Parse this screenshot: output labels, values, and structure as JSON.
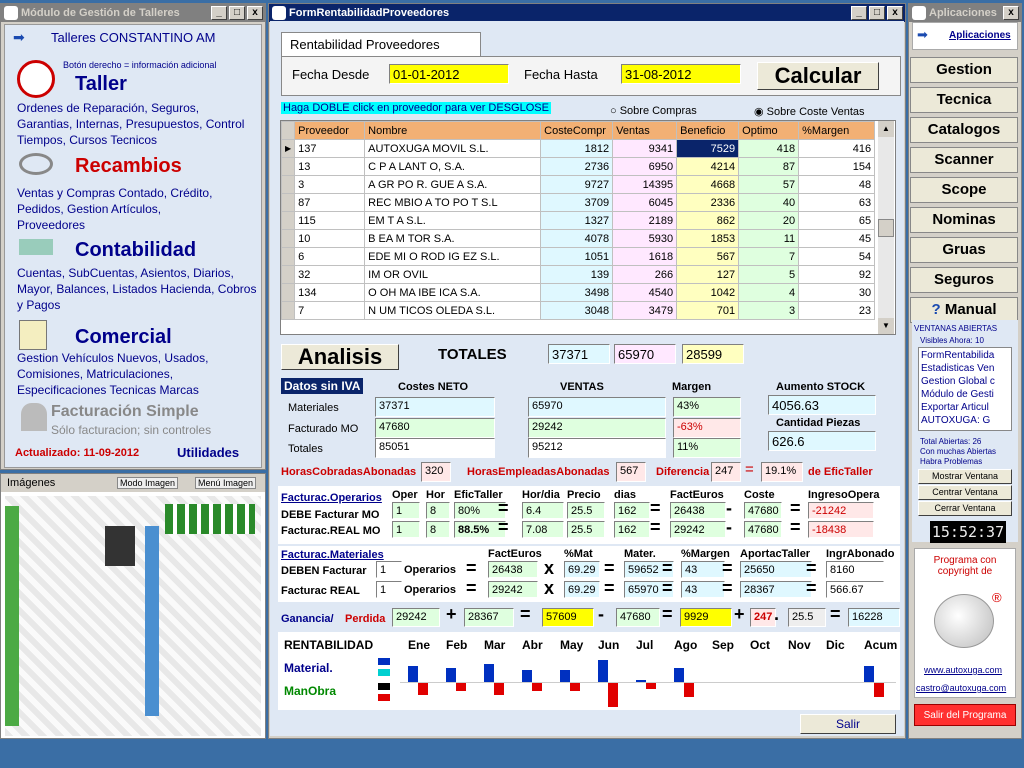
{
  "left_window": {
    "title": "Módulo de Gestión de Talleres",
    "company": "Talleres CONSTANTINO AM",
    "hint": "Botón derecho = información adicional",
    "taller": {
      "title": "Taller",
      "desc": "Ordenes de Reparación, Seguros, Garantias, Internas, Presupuestos, Control Tiempos, Cursos Tecnicos"
    },
    "recambios": {
      "title": "Recambios",
      "desc": "Ventas y Compras Contado, Crédito, Pedidos, Gestion Artículos, Proveedores"
    },
    "contabilidad": {
      "title": "Contabilidad",
      "desc": "Cuentas, SubCuentas, Asientos, Diarios, Mayor, Balances, Listados Hacienda, Cobros y Pagos"
    },
    "comercial": {
      "title": "Comercial",
      "desc": "Gestion Vehículos Nuevos, Usados, Comisiones, Matriculaciones, Especificaciones Tecnicas Marcas"
    },
    "facturacion": {
      "title": "Facturación Simple",
      "desc": "Sólo facturacion; sin controles"
    },
    "updated": "Actualizado: 11-09-2012",
    "utilidades": "Utilidades"
  },
  "images_panel": {
    "title": "Imágenes",
    "mode": "Modo Imagen",
    "menu": "Menú Imagen"
  },
  "form": {
    "title": "FormRentabilidadProveedores",
    "tab": "Rentabilidad Proveedores",
    "fecha_desde_label": "Fecha Desde",
    "fecha_desde": "01-01-2012",
    "fecha_hasta_label": "Fecha Hasta",
    "fecha_hasta": "31-08-2012",
    "calcular": "Calcular",
    "hint": "Haga DOBLE click en proveedor para ver DESGLOSE",
    "radio1": "Sobre Compras",
    "radio2": "Sobre Coste Ventas",
    "columns": [
      "Proveedor",
      "Nombre",
      "CosteCompr",
      "Ventas",
      "Beneficio",
      "Optimo",
      "%Margen"
    ],
    "rows": [
      [
        "137",
        "AUTOXUGA MOVIL S.L.",
        "1812",
        "9341",
        "7529",
        "418",
        "416"
      ],
      [
        "13",
        "C   P  A  LANT   O, S.A.",
        "2736",
        "6950",
        "4214",
        "87",
        "154"
      ],
      [
        "3",
        "A   GR  PO R. GUE   A S.A.",
        "9727",
        "14395",
        "4668",
        "57",
        "48"
      ],
      [
        "87",
        "REC  MBIO   A  TO  PO  T S.L",
        "3709",
        "6045",
        "2336",
        "40",
        "63"
      ],
      [
        "115",
        "EM  T  A S.L.",
        "1327",
        "2189",
        "862",
        "20",
        "65"
      ],
      [
        "10",
        "B  EA M   TOR S.A.",
        "4078",
        "5930",
        "1853",
        "11",
        "45"
      ],
      [
        "6",
        "EDE  MI  O ROD  IG  EZ S.L.",
        "1051",
        "1618",
        "567",
        "7",
        "54"
      ],
      [
        "32",
        "IM  OR   OVIL",
        "139",
        "266",
        "127",
        "5",
        "92"
      ],
      [
        "134",
        "  O  OH  MA IBE   ICA S.A.",
        "3498",
        "4540",
        "1042",
        "4",
        "30"
      ],
      [
        "7",
        "N  UM  TICOS   OLEDA  S.L.",
        "3048",
        "3479",
        "701",
        "3",
        "23"
      ]
    ],
    "analisis": "Analisis",
    "totales_label": "TOTALES",
    "tot1": "37371",
    "tot2": "65970",
    "tot3": "28599",
    "datos_iva": "Datos sin IVA",
    "costes_neto": "Costes NETO",
    "ventas": "VENTAS",
    "margen": "Margen",
    "aumento_stock": "Aumento STOCK",
    "cantidad_piezas": "Cantidad Piezas",
    "materiales_lbl": "Materiales",
    "facturado_lbl": "Facturado MO",
    "totales_lbl": "Totales",
    "mat_coste": "37371",
    "mat_ventas": "65970",
    "mat_margen": "43%",
    "stock": "4056.63",
    "mo_coste": "47680",
    "mo_ventas": "29242",
    "mo_margen": "-63%",
    "piezas": "626.6",
    "tot_coste": "85051",
    "tot_ventas": "95212",
    "tot_margen": "11%",
    "horas_cob_lbl": "HorasCobradasAbonadas",
    "horas_cob": "320",
    "horas_emp_lbl": "HorasEmpleadasAbonadas",
    "horas_emp": "567",
    "dif_lbl": "Diferencia",
    "dif": "247",
    "eq": "=",
    "dif_pct": "19.1%",
    "de_efic": "de EficTaller",
    "fo_lbl": "Facturac.Operarios",
    "fo_heads": [
      "Oper",
      "Hor",
      "EficTaller",
      "Hor/dia",
      "Precio",
      "dias",
      "FactEuros",
      "Coste",
      "IngresoOpera"
    ],
    "debe_mo_lbl": "DEBE Facturar MO",
    "debe_mo": [
      "1",
      "8",
      "80%",
      "6.4",
      "25.5",
      "162",
      "26438",
      "47680",
      "-21242"
    ],
    "real_mo_lbl": "Facturac.REAL MO",
    "real_mo": [
      "1",
      "8",
      "88.5%",
      "7.08",
      "25.5",
      "162",
      "29242",
      "47680",
      "-18438"
    ],
    "fm_lbl": "Facturac.Materiales",
    "fm_heads": [
      "FactEuros",
      "%Mat",
      "Mater.",
      "%Margen",
      "AportacTaller",
      "IngrAbonado"
    ],
    "deben_lbl": "DEBEN Facturar",
    "operarios": "Operarios",
    "deben": [
      "1",
      "26438",
      "69.29",
      "59652",
      "43",
      "25650",
      "8160"
    ],
    "freal_lbl": "Facturac REAL",
    "freal": [
      "1",
      "29242",
      "69.29",
      "65970",
      "43",
      "28367",
      "566.67"
    ],
    "ganancia_lbl": "Ganancia/",
    "perdida_lbl": "Perdida",
    "gan": [
      "29242",
      "28367",
      "57609",
      "47680",
      "9929",
      "247",
      "25.5",
      "16228"
    ],
    "rent_lbl": "RENTABILIDAD",
    "months": [
      "Ene",
      "Feb",
      "Mar",
      "Abr",
      "May",
      "Jun",
      "Jul",
      "Ago",
      "Sep",
      "Oct",
      "Nov",
      "Dic",
      "Acum"
    ],
    "material_lbl": "Material.",
    "manobra_lbl": "ManObra",
    "salir": "Salir"
  },
  "right_window": {
    "title": "Aplicaciones",
    "apps": "Aplicaciones",
    "buttons": [
      "Gestion",
      "Tecnica",
      "Catalogos",
      "Scanner",
      "Scope",
      "Nominas",
      "Gruas",
      "Seguros",
      "Manual"
    ],
    "ventanas": "VENTANAS ABIERTAS",
    "visibles": "Visibles Ahora: 10",
    "list": [
      "FormRentabilida",
      "Estadisticas Ven",
      "Gestion Global c",
      "Módulo de Gesti",
      "Exportar Articul",
      "AUTOXUGA: G"
    ],
    "total": "Total Abiertas: 26",
    "con_muchas": "Con muchas Abiertas",
    "habra": "Habra Problemas",
    "mostrar": "Mostrar Ventana",
    "centrar": "Centrar Ventana",
    "cerrar": "Cerrar Ventana",
    "clock": "15:52:37",
    "copyright": "Programa con copyright de",
    "web": "www.autoxuga.com",
    "email": "castro@autoxuga.com",
    "salir": "Salir del Programa"
  }
}
